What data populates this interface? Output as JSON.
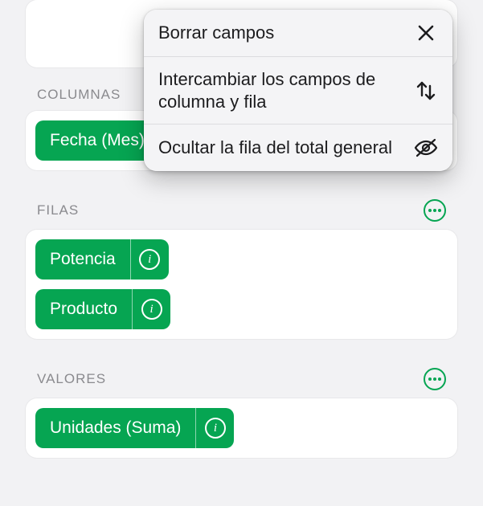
{
  "colors": {
    "accent": "#06a552",
    "background": "#f2f2f4",
    "text": "#1c1c1e",
    "muted": "#8a8a8e"
  },
  "sections": {
    "columnas": {
      "title": "COLUMNAS",
      "chips": [
        {
          "label": "Fecha (Mes)"
        }
      ]
    },
    "filas": {
      "title": "FILAS",
      "chips": [
        {
          "label": "Potencia"
        },
        {
          "label": "Producto"
        }
      ]
    },
    "valores": {
      "title": "VALORES",
      "chips": [
        {
          "label": "Unidades (Suma)"
        }
      ]
    }
  },
  "popover": {
    "items": [
      {
        "label": "Borrar campos",
        "icon": "close"
      },
      {
        "label": "Intercambiar los campos de columna y fila",
        "icon": "swap"
      },
      {
        "label": "Ocultar la fila del total general",
        "icon": "eye-off"
      }
    ]
  }
}
